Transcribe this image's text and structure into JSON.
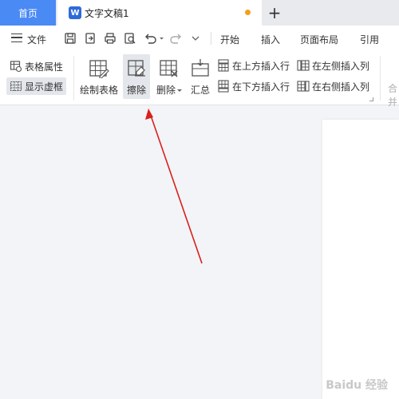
{
  "tabs": {
    "home_label": "首页",
    "doc_badge": "W",
    "doc_title": "文字文稿1",
    "new_tab_label": "+"
  },
  "menu": {
    "file_label": "文件",
    "tabs": [
      "开始",
      "插入",
      "页面布局",
      "引用"
    ]
  },
  "ribbon": {
    "table_properties": "表格属性",
    "show_gridlines": "显示虚框",
    "draw_table": "绘制表格",
    "erase": "擦除",
    "delete": "删除",
    "summary": "汇总",
    "insert_row_above": "在上方插入行",
    "insert_row_below": "在下方插入行",
    "insert_col_left": "在左侧插入列",
    "insert_col_right": "在右侧插入列",
    "faded_next": "合并"
  },
  "watermark": "Baidu 经验",
  "colors": {
    "accent": "#4a8af4",
    "annotation_arrow": "#d9201c",
    "unsaved": "#f2a01b"
  }
}
